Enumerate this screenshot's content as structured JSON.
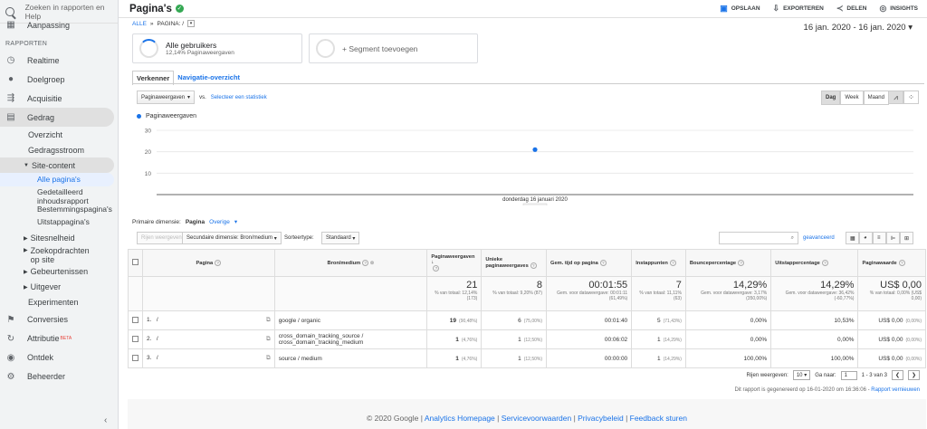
{
  "search": {
    "placeholder": "Zoeken in rapporten en Help"
  },
  "sidebar": {
    "top_item": "Aanpassing",
    "section_label": "RAPPORTEN",
    "items": [
      {
        "label": "Realtime",
        "icon": "clock-icon"
      },
      {
        "label": "Doelgroep",
        "icon": "person-icon"
      },
      {
        "label": "Acquisitie",
        "icon": "acquisition-icon"
      },
      {
        "label": "Gedrag",
        "icon": "behavior-icon"
      }
    ],
    "gedrag_sub": [
      "Overzicht",
      "Gedragsstroom"
    ],
    "site_content": "Site-content",
    "site_content_sub": [
      "Alle pagina's",
      "Gedetailleerd inhoudsrapport",
      "Bestemmingspagina's",
      "Uitstappagina's"
    ],
    "more_sub": [
      "Sitesnelheid",
      "Zoekopdrachten op site",
      "Gebeurtenissen",
      "Uitgever"
    ],
    "experimenten": "Experimenten",
    "bottom": [
      {
        "label": "Conversies",
        "icon": "flag-icon"
      },
      {
        "label": "Attributie",
        "icon": "attribution-icon",
        "badge": "BETA"
      },
      {
        "label": "Ontdek",
        "icon": "lightbulb-icon"
      },
      {
        "label": "Beheerder",
        "icon": "gear-icon"
      }
    ]
  },
  "header": {
    "title": "Pagina's",
    "actions": [
      "OPSLAAN",
      "EXPORTEREN",
      "DELEN",
      "INSIGHTS"
    ]
  },
  "breadcrumb": {
    "all": "ALLE",
    "sep": "»",
    "current": "PAGINA: /"
  },
  "date_range": "16 jan. 2020 - 16 jan. 2020",
  "segments": {
    "active_title": "Alle gebruikers",
    "active_sub": "12,14% Paginaweergaven",
    "add": "+ Segment toevoegen"
  },
  "tabs": [
    "Verkenner",
    "Navigatie-overzicht"
  ],
  "metric": {
    "select": "Paginaweergaven",
    "vs": "vs.",
    "link": "Selecteer een statistiek"
  },
  "granularity": [
    "Dag",
    "Week",
    "Maand"
  ],
  "legend": "Paginaweergaven",
  "chart_data": {
    "type": "scatter",
    "x": [
      "donderdag 16 januari 2020"
    ],
    "series": [
      {
        "name": "Paginaweergaven",
        "values": [
          21
        ]
      }
    ],
    "yticks": [
      10,
      20,
      30
    ],
    "ylim": [
      0,
      30
    ],
    "xlabel": "donderdag 16 januari 2020",
    "grid": true
  },
  "dimension": {
    "label": "Primaire dimensie:",
    "value": "Pagina",
    "other": "Overige"
  },
  "tools": {
    "plot_rows": "Rijen weergeven",
    "secondary": "Secundaire dimensie: Bron/medium",
    "sort_label": "Sorteertype:",
    "sort_value": "Standaard",
    "advanced": "geavanceerd"
  },
  "table": {
    "headers": [
      "Pagina",
      "Bron/medium",
      "Paginaweergaven",
      "Unieke paginaweergaves",
      "Gem. tijd op pagina",
      "Instappunten",
      "Bouncepercentage",
      "Uitstappercentage",
      "Paginawaarde"
    ],
    "totals": [
      {
        "big": "21",
        "small": "% van totaal: 12,14% (173)"
      },
      {
        "big": "8",
        "small": "% van totaal: 9,20% (87)"
      },
      {
        "big": "00:01:55",
        "small": "Gem. voor dataweergave: 00:01:11 (61,49%)"
      },
      {
        "big": "7",
        "small": "% van totaal: 11,11% (63)"
      },
      {
        "big": "14,29%",
        "small": "Gem. voor dataweergave: 3,17% (350,00%)"
      },
      {
        "big": "14,29%",
        "small": "Gem. voor dataweergave: 36,42% (-60,77%)"
      },
      {
        "big": "US$ 0,00",
        "small": "% van totaal: 0,00% (US$ 0,00)"
      }
    ],
    "rows": [
      {
        "idx": "1.",
        "page": "/",
        "source": "google / organic",
        "pv": "19",
        "pv_pct": "(90,48%)",
        "upv": "6",
        "upv_pct": "(75,00%)",
        "time": "00:01:40",
        "entr": "5",
        "entr_pct": "(71,43%)",
        "bounce": "0,00%",
        "exit": "10,53%",
        "value": "US$ 0,00",
        "value_pct": "(0,00%)"
      },
      {
        "idx": "2.",
        "page": "/",
        "source": "cross_domain_tracking_source / cross_domain_tracking_medium",
        "pv": "1",
        "pv_pct": "(4,76%)",
        "upv": "1",
        "upv_pct": "(12,50%)",
        "time": "00:06:02",
        "entr": "1",
        "entr_pct": "(14,29%)",
        "bounce": "0,00%",
        "exit": "0,00%",
        "value": "US$ 0,00",
        "value_pct": "(0,00%)"
      },
      {
        "idx": "3.",
        "page": "/",
        "source": "source / medium",
        "pv": "1",
        "pv_pct": "(4,76%)",
        "upv": "1",
        "upv_pct": "(12,50%)",
        "time": "00:00:00",
        "entr": "1",
        "entr_pct": "(14,29%)",
        "bounce": "100,00%",
        "exit": "100,00%",
        "value": "US$ 0,00",
        "value_pct": "(0,00%)"
      }
    ]
  },
  "pager": {
    "rows_label": "Rijen weergeven:",
    "rows": "10",
    "goto": "Ga naar:",
    "page": "1",
    "range": "1 - 3 van 3"
  },
  "generated": "Dit rapport is gegenereerd op 16-01-2020 om 16:36:06 -",
  "refresh": "Rapport vernieuwen",
  "footer": {
    "copy": "© 2020 Google",
    "links": [
      "Analytics Homepage",
      "Servicevoorwaarden",
      "Privacybeleid",
      "Feedback sturen"
    ]
  }
}
